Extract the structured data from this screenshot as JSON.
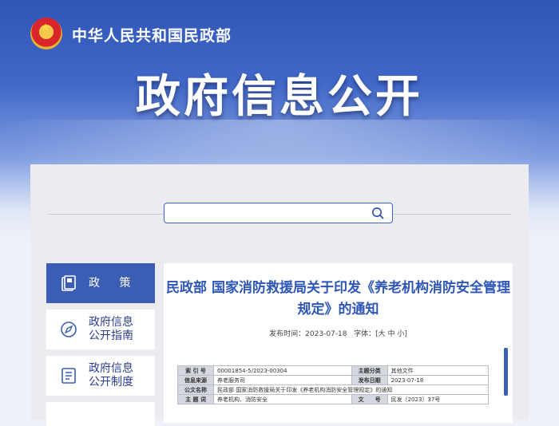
{
  "header": {
    "ministry": "中华人民共和国民政部",
    "title": "政府信息公开",
    "emblem_icon": "national-emblem-icon"
  },
  "search": {
    "placeholder": "",
    "value": ""
  },
  "sidebar": {
    "items": [
      {
        "label": "政 策",
        "icon": "document-stack-icon",
        "active": true
      },
      {
        "label": "政府信息\n公开指南",
        "icon": "compass-icon",
        "active": false
      },
      {
        "label": "政府信息\n公开制度",
        "icon": "list-document-icon",
        "active": false
      }
    ]
  },
  "document": {
    "title": "民政部 国家消防救援局关于印发《养老机构消防安全管理规定》的通知",
    "date_label": "发布时间：",
    "date": "2023-07-18",
    "font_label": "字体：",
    "font_options": "[大 中 小]",
    "table": {
      "rows": [
        {
          "k1": "索 引 号",
          "v1": "00001854-5/2023-00304",
          "k2": "主题分类",
          "v2": "其他文件"
        },
        {
          "k1": "信息来源",
          "v1": "养老服务司",
          "k2": "发布日期",
          "v2": "2023-07-18"
        },
        {
          "k1": "公文名称",
          "v1": "民政部 国家消防救援局关于印发《养老机构消防安全管理规定》的通知"
        },
        {
          "k1": "主 题 词",
          "v1": "养老机构、消防安全",
          "k2": "文　　号",
          "v2": "民发〔2023〕37号"
        }
      ]
    }
  },
  "colors": {
    "primary": "#3b5db3",
    "title_blue": "#2d56b7",
    "banner_top": "#2f55b6"
  }
}
